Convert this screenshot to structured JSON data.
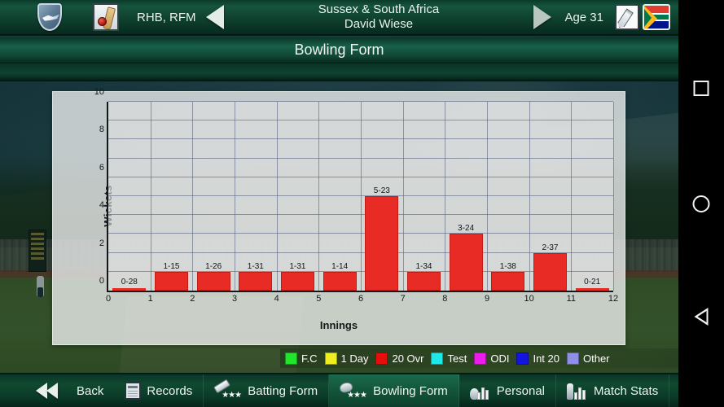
{
  "header": {
    "crest_icon": "sussex-shield-crest",
    "bat_icon": "cricket-bat-ball-icon",
    "hand_style": "RHB, RFM",
    "prev_icon": "left-triangle-arrow",
    "team": "Sussex & South Africa",
    "player_name": "David Wiese",
    "next_icon": "right-triangle-arrow",
    "age": "Age 31",
    "edit_icon": "pencil-icon",
    "flag_icon": "south-africa-flag"
  },
  "screen": {
    "title": "Bowling Form"
  },
  "chart_data": {
    "type": "bar",
    "title": "Bowling Form",
    "xlabel": "Innings",
    "ylabel": "Wickets",
    "xlim": [
      0,
      12
    ],
    "ylim": [
      0,
      10
    ],
    "grid": true,
    "xticks": [
      "0",
      "1",
      "2",
      "3",
      "4",
      "5",
      "6",
      "7",
      "8",
      "9",
      "10",
      "11",
      "12"
    ],
    "yticks": [
      "0",
      "2",
      "4",
      "6",
      "8",
      "10"
    ],
    "bar_color": "#e82b24",
    "categories": [
      1,
      2,
      3,
      4,
      5,
      6,
      7,
      8,
      9,
      10,
      11,
      12
    ],
    "values": [
      0,
      1,
      1,
      1,
      1,
      1,
      5,
      1,
      3,
      1,
      2,
      0
    ],
    "point_labels": [
      "0-28",
      "1-15",
      "1-26",
      "1-31",
      "1-31",
      "1-14",
      "5-23",
      "1-34",
      "3-24",
      "1-38",
      "2-37",
      "0-21"
    ],
    "legend_position": "bottom-right",
    "legend": [
      {
        "label": "F.C",
        "color": "#22e52b"
      },
      {
        "label": "1 Day",
        "color": "#eded22"
      },
      {
        "label": "20 Ovr",
        "color": "#e60d0d"
      },
      {
        "label": "Test",
        "color": "#21e8e8"
      },
      {
        "label": "ODI",
        "color": "#ec1cec"
      },
      {
        "label": "Int 20",
        "color": "#1414e0"
      },
      {
        "label": "Other",
        "color": "#8f8fe8"
      }
    ]
  },
  "tabs": [
    {
      "label": "Back",
      "icon": "double-left-arrow-icon",
      "active": false
    },
    {
      "label": "Records",
      "icon": "records-clipboard-icon",
      "active": false
    },
    {
      "label": "Batting Form",
      "icon": "bat-stars-icon",
      "active": false
    },
    {
      "label": "Bowling Form",
      "icon": "ball-stars-icon",
      "active": true
    },
    {
      "label": "Personal",
      "icon": "ball-barchart-icon",
      "active": false
    },
    {
      "label": "Match Stats",
      "icon": "bat-barchart-icon",
      "active": false
    }
  ],
  "system_nav": {
    "recents_icon": "square-recents-icon",
    "home_icon": "circle-home-icon",
    "back_icon": "triangle-back-icon"
  }
}
